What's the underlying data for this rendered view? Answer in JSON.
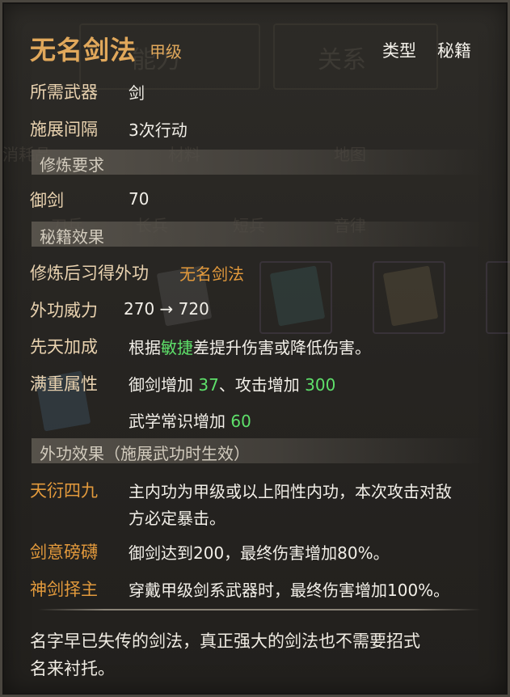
{
  "skill": {
    "name": "无名剑法",
    "grade": "甲级"
  },
  "type": {
    "label": "类型",
    "value": "秘籍"
  },
  "requirements": [
    {
      "label": "所需武器",
      "value": "剑"
    },
    {
      "label": "施展间隔",
      "value": "3次行动"
    }
  ],
  "cultivation": {
    "header": "修炼要求",
    "items": [
      {
        "label": "御剑",
        "value": "70"
      }
    ]
  },
  "effects": {
    "header": "秘籍效果",
    "learn_label": "修炼后习得外功",
    "learn_value": "无名剑法",
    "power_label": "外功威力",
    "power_from": "270",
    "power_arrow": "→",
    "power_to": "720",
    "innate_label": "先天加成",
    "innate_pre": "根据",
    "innate_attr": "敏捷",
    "innate_post": "差提升伤害或降低伤害。",
    "max_label": "满重属性",
    "max_items": [
      {
        "label": "御剑增加",
        "value": "37",
        "sep": "、"
      },
      {
        "label": "攻击增加",
        "value": "300"
      },
      {
        "label": "武学常识增加",
        "value": "60"
      }
    ]
  },
  "martial": {
    "header": "外功效果（施展武功时生效）",
    "items": [
      {
        "name": "天衍四九",
        "desc_line1": "主内功为甲级或以上阳性内功，本次攻击对敌",
        "desc_line2": "方必定暴击。"
      },
      {
        "name": "剑意磅礴",
        "desc": "御剑达到200，最终伤害增加80%。"
      },
      {
        "name": "神剑择主",
        "desc": "穿戴甲级剑系武器时，最终伤害增加100%。"
      }
    ]
  },
  "flavor": {
    "line1": "名字早已失传的剑法，真正强大的剑法也不需要招式",
    "line2": "名来衬托。"
  },
  "background": {
    "tab1": "能力",
    "tab2": "关系",
    "menu1": "消耗品",
    "menu2": "材料",
    "menu3": "地图",
    "opt1": "刀兵",
    "opt2": "长兵",
    "opt3": "短兵",
    "opt4": "音律"
  }
}
